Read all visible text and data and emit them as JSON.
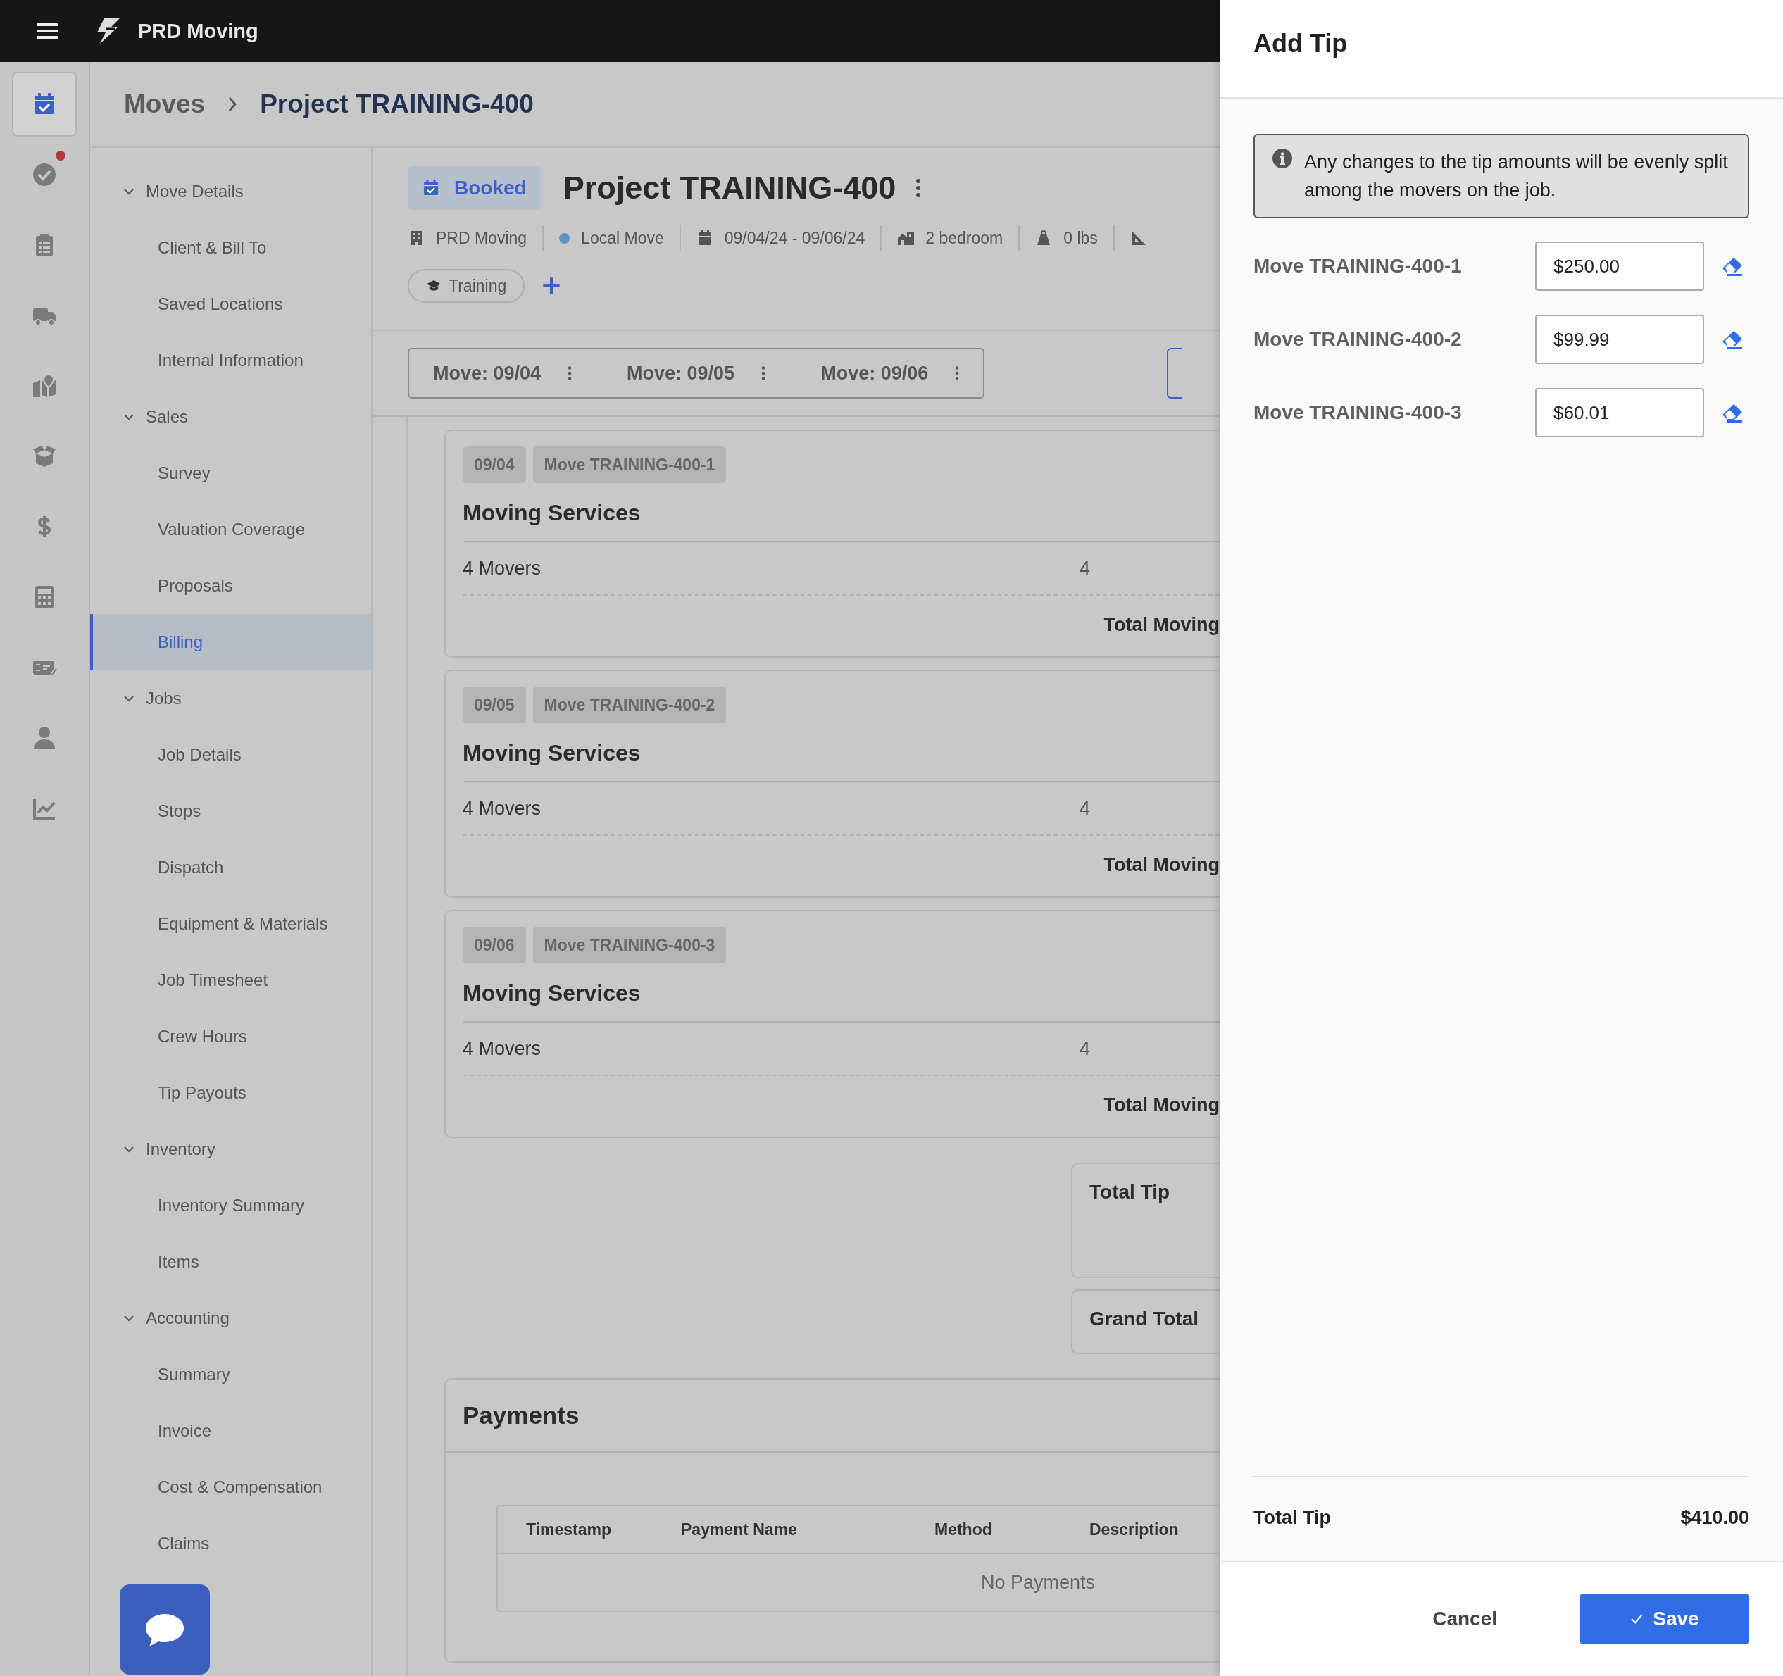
{
  "top_bar": {
    "app_name": "PRD Moving"
  },
  "rail": [
    {
      "kind": "calendar",
      "selected": true,
      "badge": false
    },
    {
      "kind": "check",
      "selected": false,
      "badge": true
    },
    {
      "kind": "clipboard",
      "selected": false,
      "badge": false
    },
    {
      "kind": "truck",
      "selected": false,
      "badge": false
    },
    {
      "kind": "map",
      "selected": false,
      "badge": false
    },
    {
      "kind": "box",
      "selected": false,
      "badge": false
    },
    {
      "kind": "dollar",
      "selected": false,
      "badge": false
    },
    {
      "kind": "calculator",
      "selected": false,
      "badge": false
    },
    {
      "kind": "check-pen",
      "selected": false,
      "badge": false
    },
    {
      "kind": "user",
      "selected": false,
      "badge": false
    },
    {
      "kind": "chart",
      "selected": false,
      "badge": false
    }
  ],
  "breadcrumb": {
    "parent": "Moves",
    "current": "Project TRAINING-400"
  },
  "nav": [
    {
      "label": "Move Details",
      "expanded": true,
      "children": [
        {
          "label": "Client & Bill To",
          "selected": false
        },
        {
          "label": "Saved Locations",
          "selected": false
        },
        {
          "label": "Internal Information",
          "selected": false
        }
      ]
    },
    {
      "label": "Sales",
      "expanded": true,
      "children": [
        {
          "label": "Survey",
          "selected": false
        },
        {
          "label": "Valuation Coverage",
          "selected": false
        },
        {
          "label": "Proposals",
          "selected": false
        },
        {
          "label": "Billing",
          "selected": true
        }
      ]
    },
    {
      "label": "Jobs",
      "expanded": true,
      "children": [
        {
          "label": "Job Details",
          "selected": false
        },
        {
          "label": "Stops",
          "selected": false
        },
        {
          "label": "Dispatch",
          "selected": false
        },
        {
          "label": "Equipment & Materials",
          "selected": false
        },
        {
          "label": "Job Timesheet",
          "selected": false
        },
        {
          "label": "Crew Hours",
          "selected": false
        },
        {
          "label": "Tip Payouts",
          "selected": false
        }
      ]
    },
    {
      "label": "Inventory",
      "expanded": true,
      "children": [
        {
          "label": "Inventory Summary",
          "selected": false
        },
        {
          "label": "Items",
          "selected": false
        }
      ]
    },
    {
      "label": "Accounting",
      "expanded": true,
      "children": [
        {
          "label": "Summary",
          "selected": false
        },
        {
          "label": "Invoice",
          "selected": false
        },
        {
          "label": "Cost & Compensation",
          "selected": false
        },
        {
          "label": "Claims",
          "selected": false
        }
      ]
    }
  ],
  "project": {
    "status": "Booked",
    "title": "Project TRAINING-400",
    "meta": [
      {
        "kind": "building",
        "text": "PRD Moving"
      },
      {
        "kind": "dot",
        "text": "Local Move",
        "color": "#5f93c2"
      },
      {
        "kind": "calendar",
        "text": "09/04/24 - 09/06/24"
      },
      {
        "kind": "house",
        "text": "2 bedroom"
      },
      {
        "kind": "weight",
        "text": "0 lbs"
      },
      {
        "kind": "ruler"
      }
    ],
    "tags": [
      "Training"
    ]
  },
  "move_tabs": [
    {
      "label": "Move: 09/04"
    },
    {
      "label": "Move: 09/05"
    },
    {
      "label": "Move: 09/06"
    }
  ],
  "cards": [
    {
      "date": "09/04",
      "move": "Move TRAINING-400-1",
      "title": "Moving Services",
      "line": "4 Movers",
      "quantity": "4",
      "total_label": "Total Moving"
    },
    {
      "date": "09/05",
      "move": "Move TRAINING-400-2",
      "title": "Moving Services",
      "line": "4 Movers",
      "quantity": "4",
      "total_label": "Total Moving"
    },
    {
      "date": "09/06",
      "move": "Move TRAINING-400-3",
      "title": "Moving Services",
      "line": "4 Movers",
      "quantity": "4",
      "total_label": "Total Moving"
    }
  ],
  "summary": {
    "total_tip_label": "Total Tip",
    "grand_total_label": "Grand Total"
  },
  "payments": {
    "title": "Payments",
    "columns": [
      "Timestamp",
      "Payment Name",
      "Method",
      "Description"
    ],
    "empty": "No Payments"
  },
  "drawer": {
    "title": "Add Tip",
    "notice": "Any changes to the tip amounts will be evenly split among the movers on the job.",
    "tips": [
      {
        "label": "Move TRAINING-400-1",
        "value": "$250.00"
      },
      {
        "label": "Move TRAINING-400-2",
        "value": "$99.99"
      },
      {
        "label": "Move TRAINING-400-3",
        "value": "$60.01"
      }
    ],
    "total_label": "Total Tip",
    "total_value": "$410.00",
    "cancel": "Cancel",
    "save": "Save"
  }
}
